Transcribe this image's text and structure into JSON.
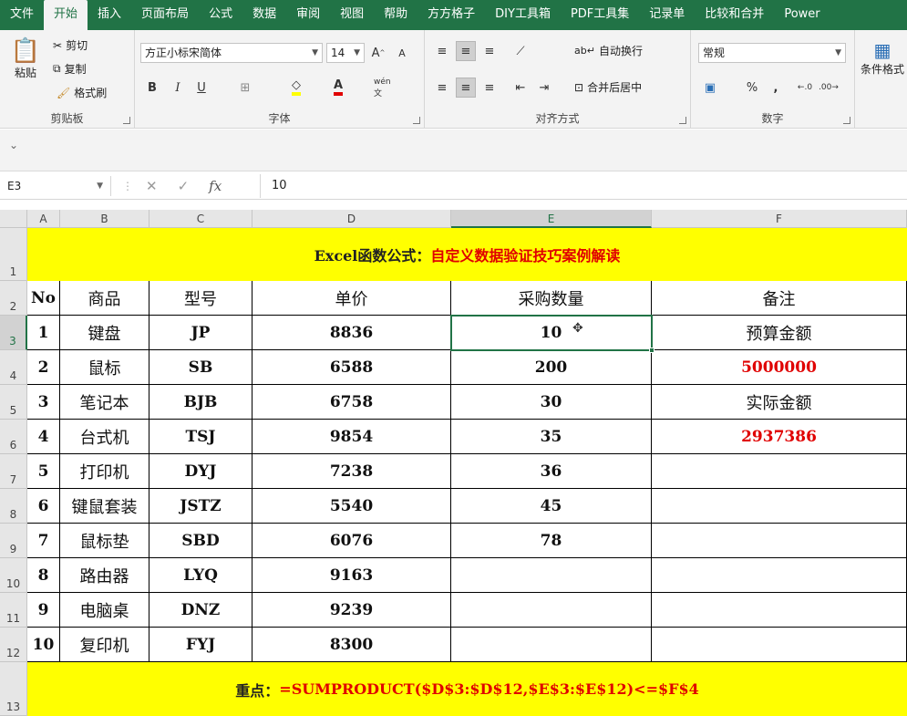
{
  "ribbon_tabs": [
    "文件",
    "开始",
    "插入",
    "页面布局",
    "公式",
    "数据",
    "审阅",
    "视图",
    "帮助",
    "方方格子",
    "DIY工具箱",
    "PDF工具集",
    "记录单",
    "比较和合并",
    "Power"
  ],
  "clipboard": {
    "paste": "粘贴",
    "cut": "剪切",
    "copy": "复制",
    "format_painter": "格式刷",
    "label": "剪贴板"
  },
  "font": {
    "name": "方正小标宋简体",
    "size": "14",
    "label": "字体",
    "bold": "B",
    "italic": "I",
    "underline": "U",
    "phonetic": "wén 文"
  },
  "alignment": {
    "wrap": "自动换行",
    "merge": "合并后居中",
    "label": "对齐方式"
  },
  "number": {
    "format": "常规",
    "label": "数字",
    "percent": "%",
    "comma": ","
  },
  "styles": {
    "conditional": "条件格式"
  },
  "qat_arrow": "⌄",
  "formula_bar": {
    "name_box": "E3",
    "fx": "fx",
    "value": "10"
  },
  "columns": [
    "A",
    "B",
    "C",
    "D",
    "E",
    "F"
  ],
  "rows": [
    "1",
    "2",
    "3",
    "4",
    "5",
    "6",
    "7",
    "8",
    "9",
    "10",
    "11",
    "12",
    "13"
  ],
  "title": {
    "black": "Excel函数公式：",
    "red": "自定义数据验证技巧案例解读"
  },
  "headers": [
    "No",
    "商品",
    "型号",
    "单价",
    "采购数量",
    "备注"
  ],
  "table": [
    [
      "1",
      "键盘",
      "JP",
      "8836",
      "10",
      "预算金额"
    ],
    [
      "2",
      "鼠标",
      "SB",
      "6588",
      "200",
      "5000000"
    ],
    [
      "3",
      "笔记本",
      "BJB",
      "6758",
      "30",
      "实际金额"
    ],
    [
      "4",
      "台式机",
      "TSJ",
      "9854",
      "35",
      "2937386"
    ],
    [
      "5",
      "打印机",
      "DYJ",
      "7238",
      "36",
      ""
    ],
    [
      "6",
      "键鼠套装",
      "JSTZ",
      "5540",
      "45",
      ""
    ],
    [
      "7",
      "鼠标垫",
      "SBD",
      "6076",
      "78",
      ""
    ],
    [
      "8",
      "路由器",
      "LYQ",
      "9163",
      "",
      ""
    ],
    [
      "9",
      "电脑桌",
      "DNZ",
      "9239",
      "",
      ""
    ],
    [
      "10",
      "复印机",
      "FYJ",
      "8300",
      "",
      ""
    ]
  ],
  "footer": {
    "black": "重点：",
    "red": "=SUMPRODUCT($D$3:$D$12,$E$3:$E$12)<=$F$4"
  },
  "colors": {
    "excel_green": "#217346",
    "highlight": "#ffff00",
    "red_text": "#e00000"
  }
}
